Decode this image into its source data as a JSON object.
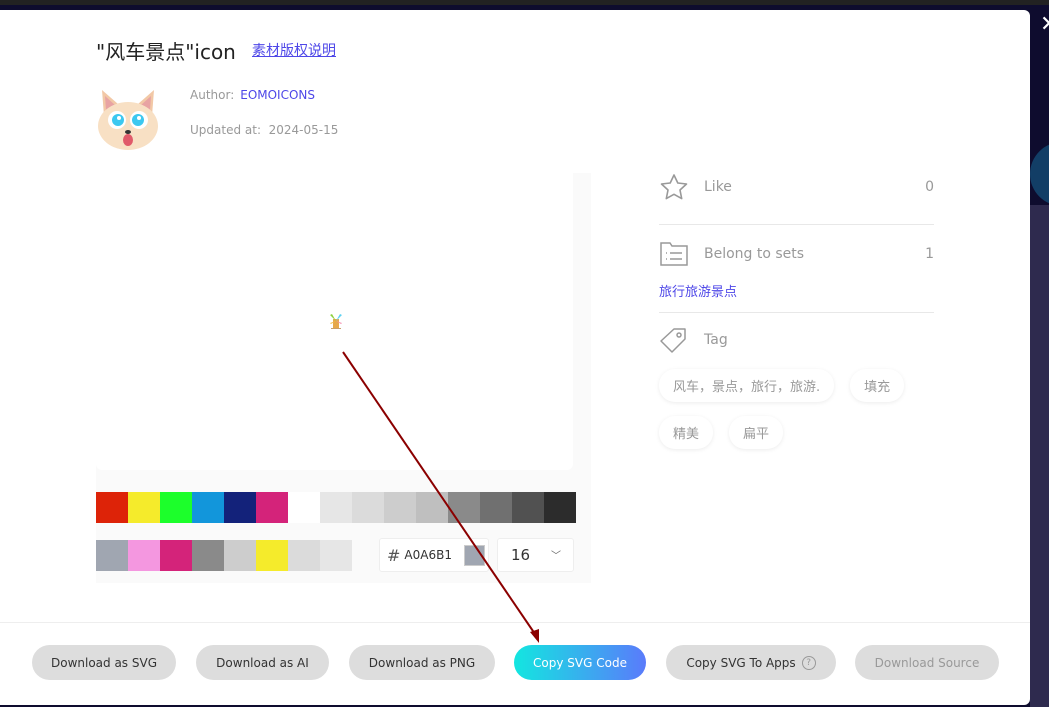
{
  "title": "\"风车景点\"icon",
  "license_link": "素材版权说明",
  "author_label": "Author:",
  "author_name": "EOMOICONS",
  "updated_label": "Updated at:",
  "updated_value": "2024-05-15",
  "palette_row1": [
    "#dd2308",
    "#f5eb2b",
    "#1cff2b",
    "#1296db",
    "#13227a",
    "#d4237a",
    "#ffffff",
    "#e6e6e6",
    "#dbdbdb",
    "#cdcdcd",
    "#bfbfbf",
    "#8a8a8a",
    "#707070",
    "#515151",
    "#2c2c2c"
  ],
  "palette_row2": [
    "#a0a6b1",
    "#f497e0",
    "#d4237a",
    "#8a8a8a",
    "#cdcdcd",
    "#f5eb2b",
    "#dbdbdb",
    "#e6e6e6"
  ],
  "color": {
    "hash": "#",
    "value": "A0A6B1",
    "swatch": "#a0a6b1"
  },
  "size": {
    "value": "16"
  },
  "like": {
    "label": "Like",
    "count": "0"
  },
  "sets": {
    "label": "Belong to sets",
    "count": "1",
    "link": "旅行旅游景点"
  },
  "tag": {
    "label": "Tag",
    "items": [
      "风车，景点，旅行，旅游.",
      "填充",
      "精美",
      "扁平"
    ]
  },
  "buttons": {
    "svg": "Download as SVG",
    "ai": "Download as AI",
    "png": "Download as PNG",
    "copy": "Copy SVG Code",
    "apps": "Copy SVG To Apps",
    "help": "?",
    "source": "Download Source"
  },
  "close": "✕"
}
